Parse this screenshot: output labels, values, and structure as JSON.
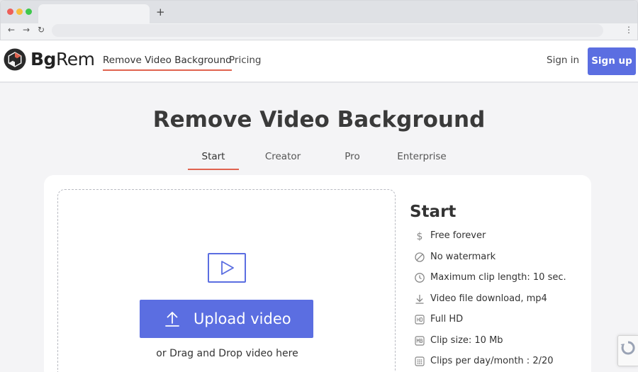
{
  "browser": {
    "new_tab_glyph": "+",
    "back_glyph": "←",
    "forward_glyph": "→",
    "reload_glyph": "↻",
    "menu_glyph": "⋮"
  },
  "header": {
    "logo_bold": "Bg",
    "logo_regular": "Rem",
    "nav": {
      "remove_bg": "Remove Video Background",
      "pricing": "Pricing"
    },
    "sign_in": "Sign in",
    "sign_up": "Sign up"
  },
  "main": {
    "title": "Remove Video Background",
    "plan_tabs": [
      "Start",
      "Creator",
      "Pro",
      "Enterprise"
    ],
    "active_tab": "Start",
    "upload": {
      "button_label": "Upload video",
      "drag_text": "or Drag and Drop video here"
    },
    "plan": {
      "title": "Start",
      "features": [
        {
          "icon": "dollar-icon",
          "label": "Free forever"
        },
        {
          "icon": "no-watermark-icon",
          "label": "No watermark"
        },
        {
          "icon": "clock-icon",
          "label": "Maximum clip length: 10 sec."
        },
        {
          "icon": "download-icon",
          "label": "Video file download, mp4"
        },
        {
          "icon": "hd-icon",
          "label": "Full HD"
        },
        {
          "icon": "mb-icon",
          "label": "Clip size: 10 Mb"
        },
        {
          "icon": "calendar-icon",
          "label": "Clips per day/month : 2/20"
        }
      ]
    }
  },
  "colors": {
    "accent": "#5b6ee1",
    "underline": "#e0634f",
    "background": "#f4f4f6"
  }
}
